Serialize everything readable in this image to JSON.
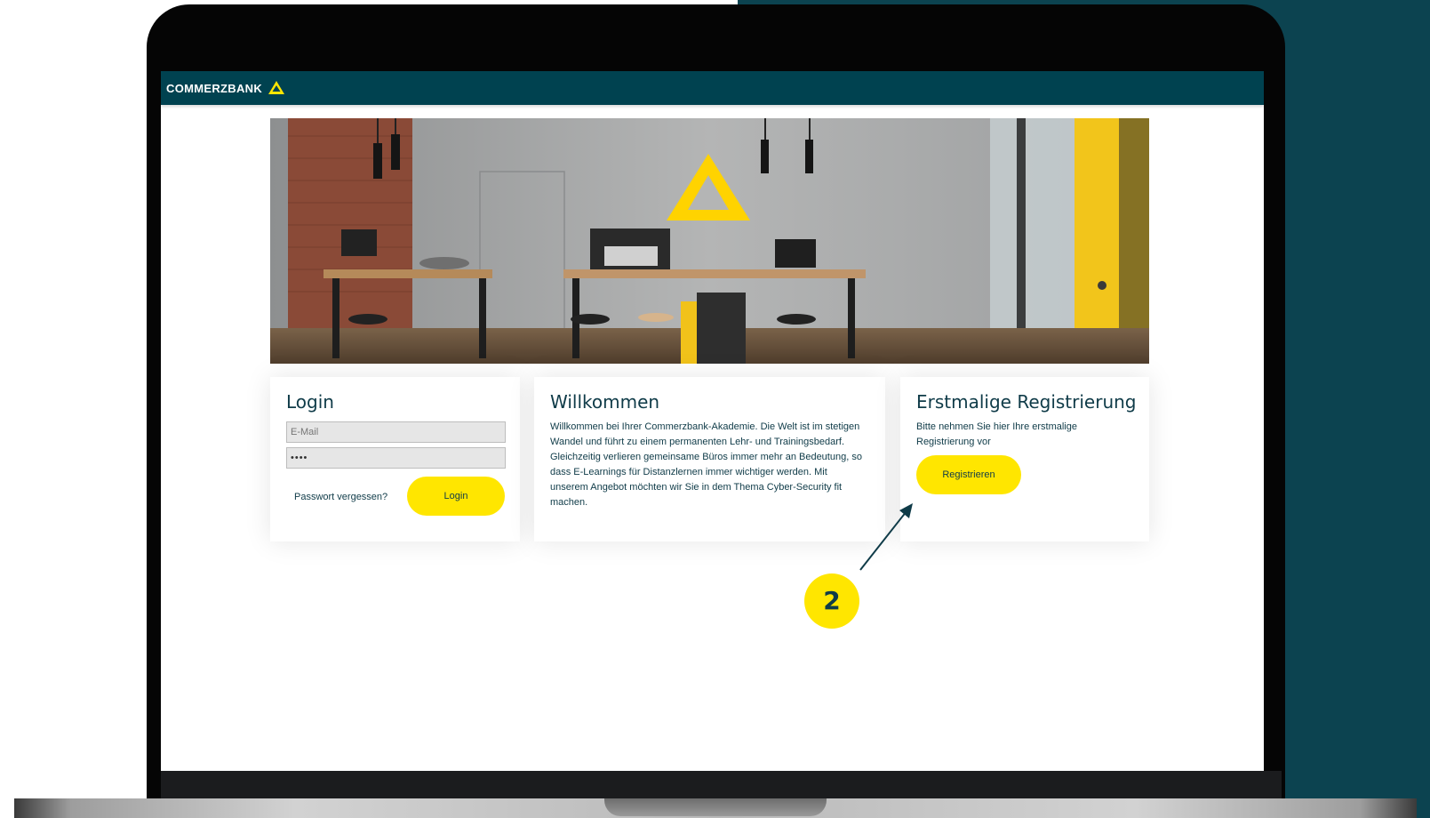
{
  "header": {
    "brand_name": "COMMERZBANK",
    "brand_color": "#004250",
    "logo_icon": "commerzbank-ribbon-logo"
  },
  "colors": {
    "accent_yellow": "#ffe600",
    "text_dark": "#0f3b48",
    "background_teal": "#0c4350"
  },
  "login": {
    "title": "Login",
    "email_placeholder": "E-Mail",
    "password_value": "••••",
    "forgot_label": "Passwort vergessen?",
    "button_label": "Login"
  },
  "welcome": {
    "title": "Willkommen",
    "text": "Willkommen bei Ihrer Commerzbank-Akademie. Die Welt ist im stetigen Wandel und führt zu einem permanenten Lehr- und Trainingsbedarf. Gleichzeitig verlieren gemeinsame Büros immer mehr an Bedeutung, so dass E-Learnings für Distanzlernen immer wichtiger werden. Mit unserem Angebot möchten wir Sie in dem Thema Cyber-Security fit machen."
  },
  "register": {
    "title": "Erstmalige Registrierung",
    "text": "Bitte nehmen Sie hier Ihre erstmalige Registrierung vor",
    "button_label": "Registrieren"
  },
  "annotation": {
    "step_number": "2"
  }
}
